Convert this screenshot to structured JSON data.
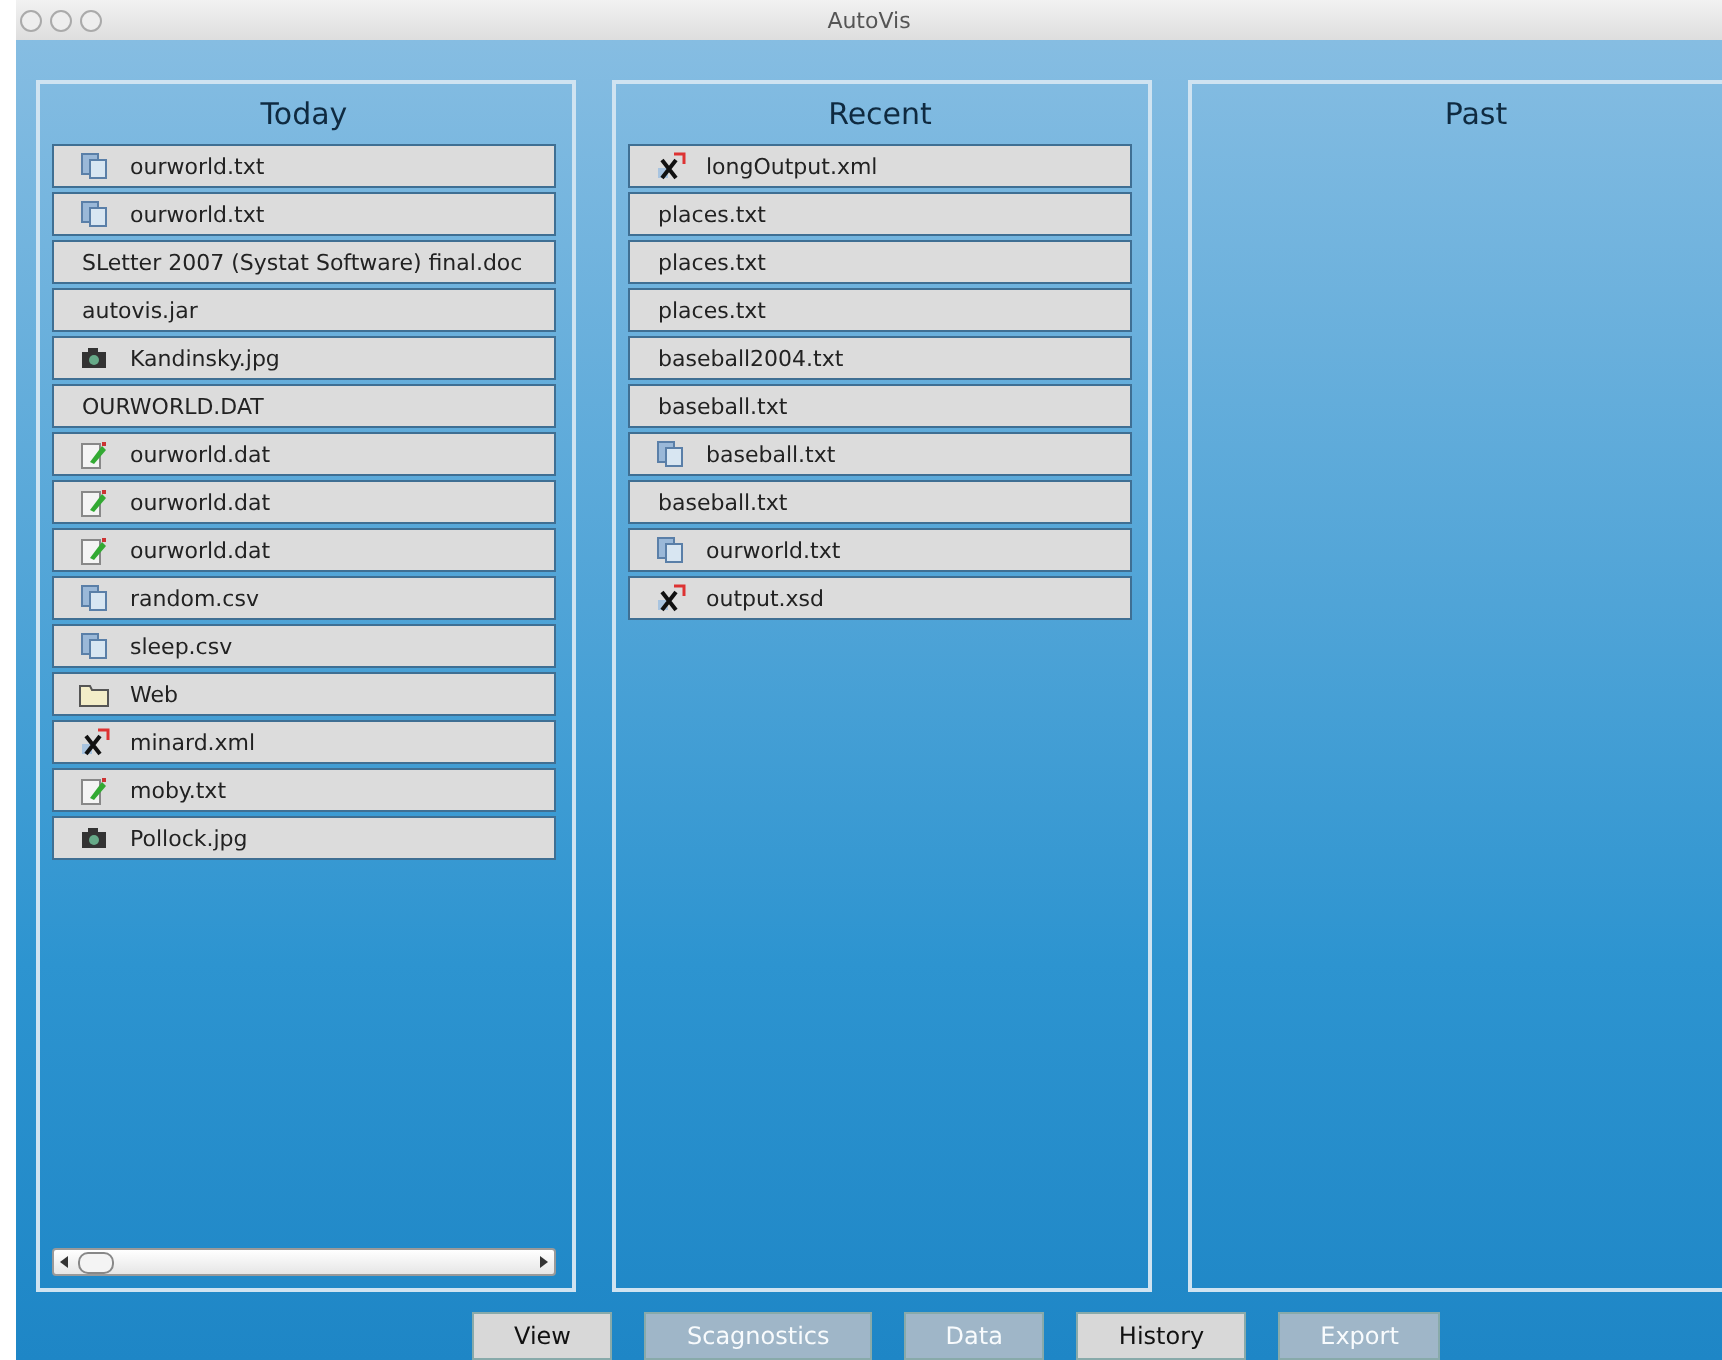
{
  "window": {
    "title": "AutoVis"
  },
  "panels": [
    {
      "title": "Today",
      "scrollbar": true,
      "items": [
        {
          "name": "ourworld.txt",
          "kind": "doc"
        },
        {
          "name": "ourworld.txt",
          "kind": "doc"
        },
        {
          "name": "SLetter 2007 (Systat Software) final.doc",
          "kind": "plain"
        },
        {
          "name": "autovis.jar",
          "kind": "plain"
        },
        {
          "name": "Kandinsky.jpg",
          "kind": "camera"
        },
        {
          "name": "OURWORLD.DAT",
          "kind": "plain"
        },
        {
          "name": "ourworld.dat",
          "kind": "edit"
        },
        {
          "name": "ourworld.dat",
          "kind": "edit"
        },
        {
          "name": "ourworld.dat",
          "kind": "edit"
        },
        {
          "name": "random.csv",
          "kind": "doc"
        },
        {
          "name": "sleep.csv",
          "kind": "doc"
        },
        {
          "name": "Web",
          "kind": "folder"
        },
        {
          "name": "minard.xml",
          "kind": "xml"
        },
        {
          "name": "moby.txt",
          "kind": "edit"
        },
        {
          "name": "Pollock.jpg",
          "kind": "camera"
        }
      ]
    },
    {
      "title": "Recent",
      "scrollbar": false,
      "items": [
        {
          "name": "longOutput.xml",
          "kind": "xml"
        },
        {
          "name": "places.txt",
          "kind": "plain"
        },
        {
          "name": "places.txt",
          "kind": "plain"
        },
        {
          "name": "places.txt",
          "kind": "plain"
        },
        {
          "name": "baseball2004.txt",
          "kind": "plain"
        },
        {
          "name": "baseball.txt",
          "kind": "plain"
        },
        {
          "name": "baseball.txt",
          "kind": "doc"
        },
        {
          "name": "baseball.txt",
          "kind": "plain"
        },
        {
          "name": "ourworld.txt",
          "kind": "doc"
        },
        {
          "name": "output.xsd",
          "kind": "xml"
        }
      ]
    },
    {
      "title": "Past",
      "scrollbar": false
    }
  ],
  "buttons": [
    {
      "label": "View",
      "disabled": false
    },
    {
      "label": "Scagnostics",
      "disabled": true
    },
    {
      "label": "Data",
      "disabled": true
    },
    {
      "label": "History",
      "disabled": false
    },
    {
      "label": "Export",
      "disabled": true
    }
  ]
}
